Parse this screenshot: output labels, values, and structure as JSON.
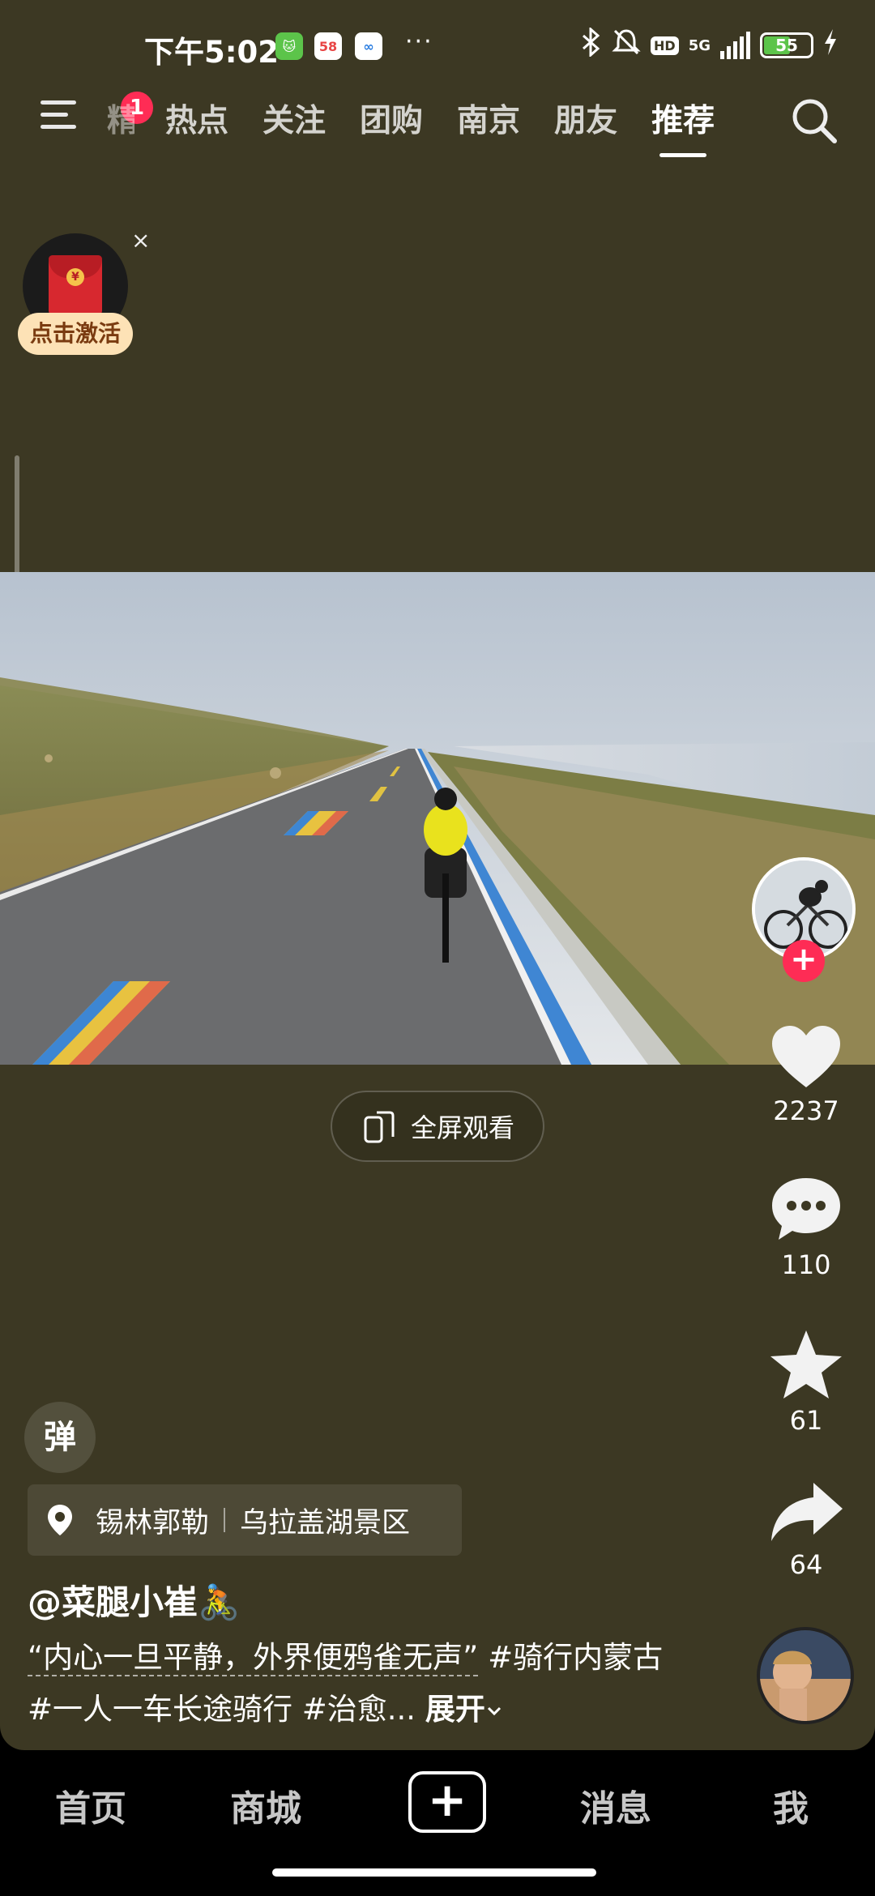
{
  "status_bar": {
    "time": "下午5:02",
    "app_icon_1": "🐱",
    "app_icon_2": "58",
    "app_icon_3": "∞",
    "more": "···",
    "hd": "HD",
    "network": "5G",
    "battery": "55"
  },
  "top_nav": {
    "menu_badge": "1",
    "tabs": [
      "精选",
      "热点",
      "关注",
      "团购",
      "南京",
      "朋友",
      "推荐"
    ],
    "active_tab": "推荐"
  },
  "red_packet": {
    "label": "点击激活",
    "close": "×"
  },
  "fullscreen": {
    "label": "全屏观看"
  },
  "right_rail": {
    "likes": "2237",
    "comments": "110",
    "favorites": "61",
    "shares": "64",
    "follow": "+"
  },
  "danmu": {
    "label": "弹"
  },
  "location": {
    "city": "锡林郭勒",
    "place": "乌拉盖湖景区"
  },
  "author": {
    "name": "@菜腿小崔🚴"
  },
  "caption": {
    "quote": "“内心一旦平静，外界便鸦雀无声”",
    "rest": " #骑行内蒙古 #一人一车长途骑行 #治愈...",
    "expand": "展开"
  },
  "bottom_nav": {
    "home": "首页",
    "mall": "商城",
    "plus": "+",
    "messages": "消息",
    "me": "我"
  }
}
